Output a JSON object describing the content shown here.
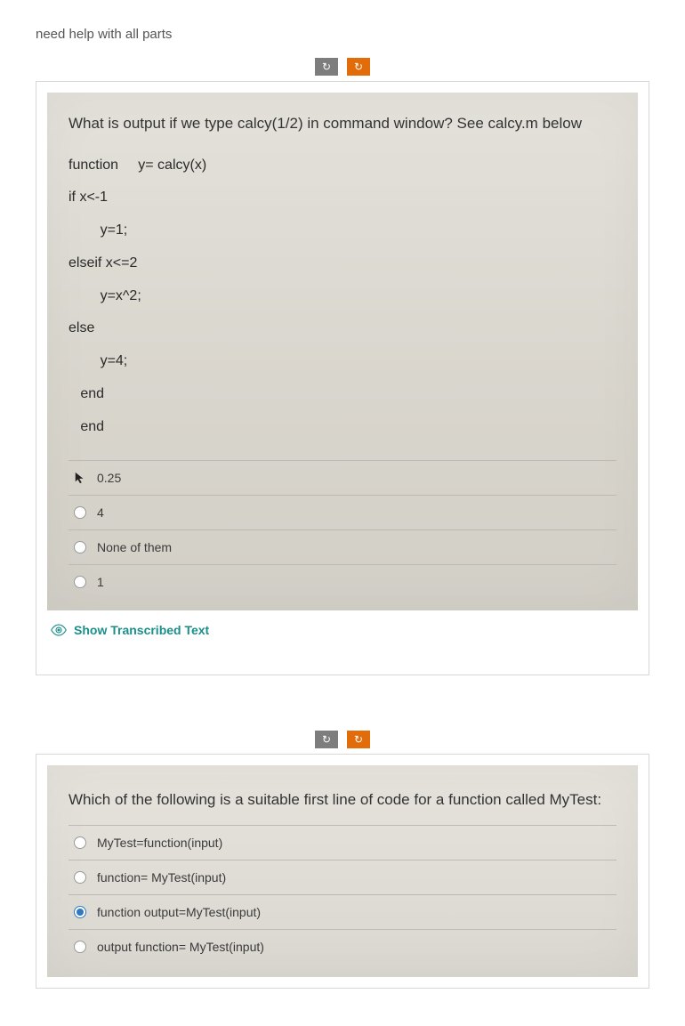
{
  "heading": "need help with all parts",
  "toolbar": {
    "refresh_icon_label": "↻",
    "redo_icon_label": "↻"
  },
  "question1": {
    "prompt": "What is output if we type calcy(1/2) in command window? See calcy.m below",
    "code_lines": [
      "function     y= calcy(x)",
      "if x<-1",
      "        y=1;",
      "elseif x<=2",
      "        y=x^2;",
      "else",
      "        y=4;",
      "   end",
      "   end"
    ],
    "options": [
      {
        "label": "0.25",
        "selected": false,
        "has_cursor": true
      },
      {
        "label": "4",
        "selected": false,
        "has_cursor": false
      },
      {
        "label": "None of them",
        "selected": false,
        "has_cursor": false
      },
      {
        "label": "1",
        "selected": false,
        "has_cursor": false
      }
    ]
  },
  "show_transcribed": "Show Transcribed Text",
  "question2": {
    "prompt": "Which of the following is a suitable first line of code for a function called MyTest:",
    "options": [
      {
        "label": "MyTest=function(input)",
        "selected": false
      },
      {
        "label": "function= MyTest(input)",
        "selected": false
      },
      {
        "label": "function output=MyTest(input)",
        "selected": true
      },
      {
        "label": "output function= MyTest(input)",
        "selected": false
      }
    ]
  }
}
